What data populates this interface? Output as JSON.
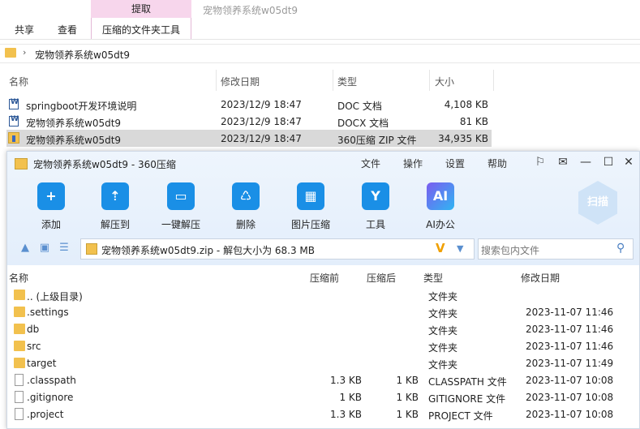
{
  "explorer": {
    "ribbon": {
      "context_tab": "提取",
      "window_title": "宠物领养系统w05dt9",
      "tabs": [
        "共享",
        "查看",
        "压缩的文件夹工具"
      ]
    },
    "address": {
      "path": "宠物领养系统w05dt9"
    },
    "columns": {
      "name": "名称",
      "modified": "修改日期",
      "type": "类型",
      "size": "大小"
    },
    "files": [
      {
        "name": "springboot开发环境说明",
        "modified": "2023/12/9 18:47",
        "type": "DOC 文档",
        "size": "4,108 KB",
        "icon": "word-doc-icon"
      },
      {
        "name": "宠物领养系统w05dt9",
        "modified": "2023/12/9 18:47",
        "type": "DOCX 文档",
        "size": "81 KB",
        "icon": "word-doc-icon"
      },
      {
        "name": "宠物领养系统w05dt9",
        "modified": "2023/12/9 18:47",
        "type": "360压缩 ZIP 文件",
        "size": "34,935 KB",
        "icon": "zip-archive-icon"
      }
    ]
  },
  "zip360": {
    "title": "宠物领养系统w05dt9 - 360压缩",
    "menu": [
      "文件",
      "操作",
      "设置",
      "帮助"
    ],
    "toolbar": [
      {
        "label": "添加",
        "icon": "add-icon"
      },
      {
        "label": "解压到",
        "icon": "extract-to-icon"
      },
      {
        "label": "一键解压",
        "icon": "one-click-extract-icon"
      },
      {
        "label": "删除",
        "icon": "delete-icon"
      },
      {
        "label": "图片压缩",
        "icon": "image-compress-icon"
      },
      {
        "label": "工具",
        "icon": "tools-icon"
      },
      {
        "label": "AI办公",
        "icon": "ai-office-icon"
      }
    ],
    "scan_label": "扫描",
    "path_text": "宠物领养系统w05dt9.zip - 解包大小为 68.3 MB",
    "search_placeholder": "搜索包内文件",
    "columns": {
      "name": "名称",
      "compressed": "压缩前",
      "after": "压缩后",
      "type": "类型",
      "modified": "修改日期"
    },
    "rows": [
      {
        "name": ".. (上级目录)",
        "before": "",
        "after": "",
        "type": "文件夹",
        "modified": "",
        "kind": "folder"
      },
      {
        "name": ".settings",
        "before": "",
        "after": "",
        "type": "文件夹",
        "modified": "2023-11-07 11:46",
        "kind": "folder"
      },
      {
        "name": "db",
        "before": "",
        "after": "",
        "type": "文件夹",
        "modified": "2023-11-07 11:46",
        "kind": "folder"
      },
      {
        "name": "src",
        "before": "",
        "after": "",
        "type": "文件夹",
        "modified": "2023-11-07 11:46",
        "kind": "folder"
      },
      {
        "name": "target",
        "before": "",
        "after": "",
        "type": "文件夹",
        "modified": "2023-11-07 11:49",
        "kind": "folder"
      },
      {
        "name": ".classpath",
        "before": "1.3 KB",
        "after": "1 KB",
        "type": "CLASSPATH 文件",
        "modified": "2023-11-07 10:08",
        "kind": "file"
      },
      {
        "name": ".gitignore",
        "before": "1 KB",
        "after": "1 KB",
        "type": "GITIGNORE 文件",
        "modified": "2023-11-07 10:08",
        "kind": "file"
      },
      {
        "name": ".project",
        "before": "1.3 KB",
        "after": "1 KB",
        "type": "PROJECT 文件",
        "modified": "2023-11-07 10:08",
        "kind": "file"
      }
    ]
  }
}
